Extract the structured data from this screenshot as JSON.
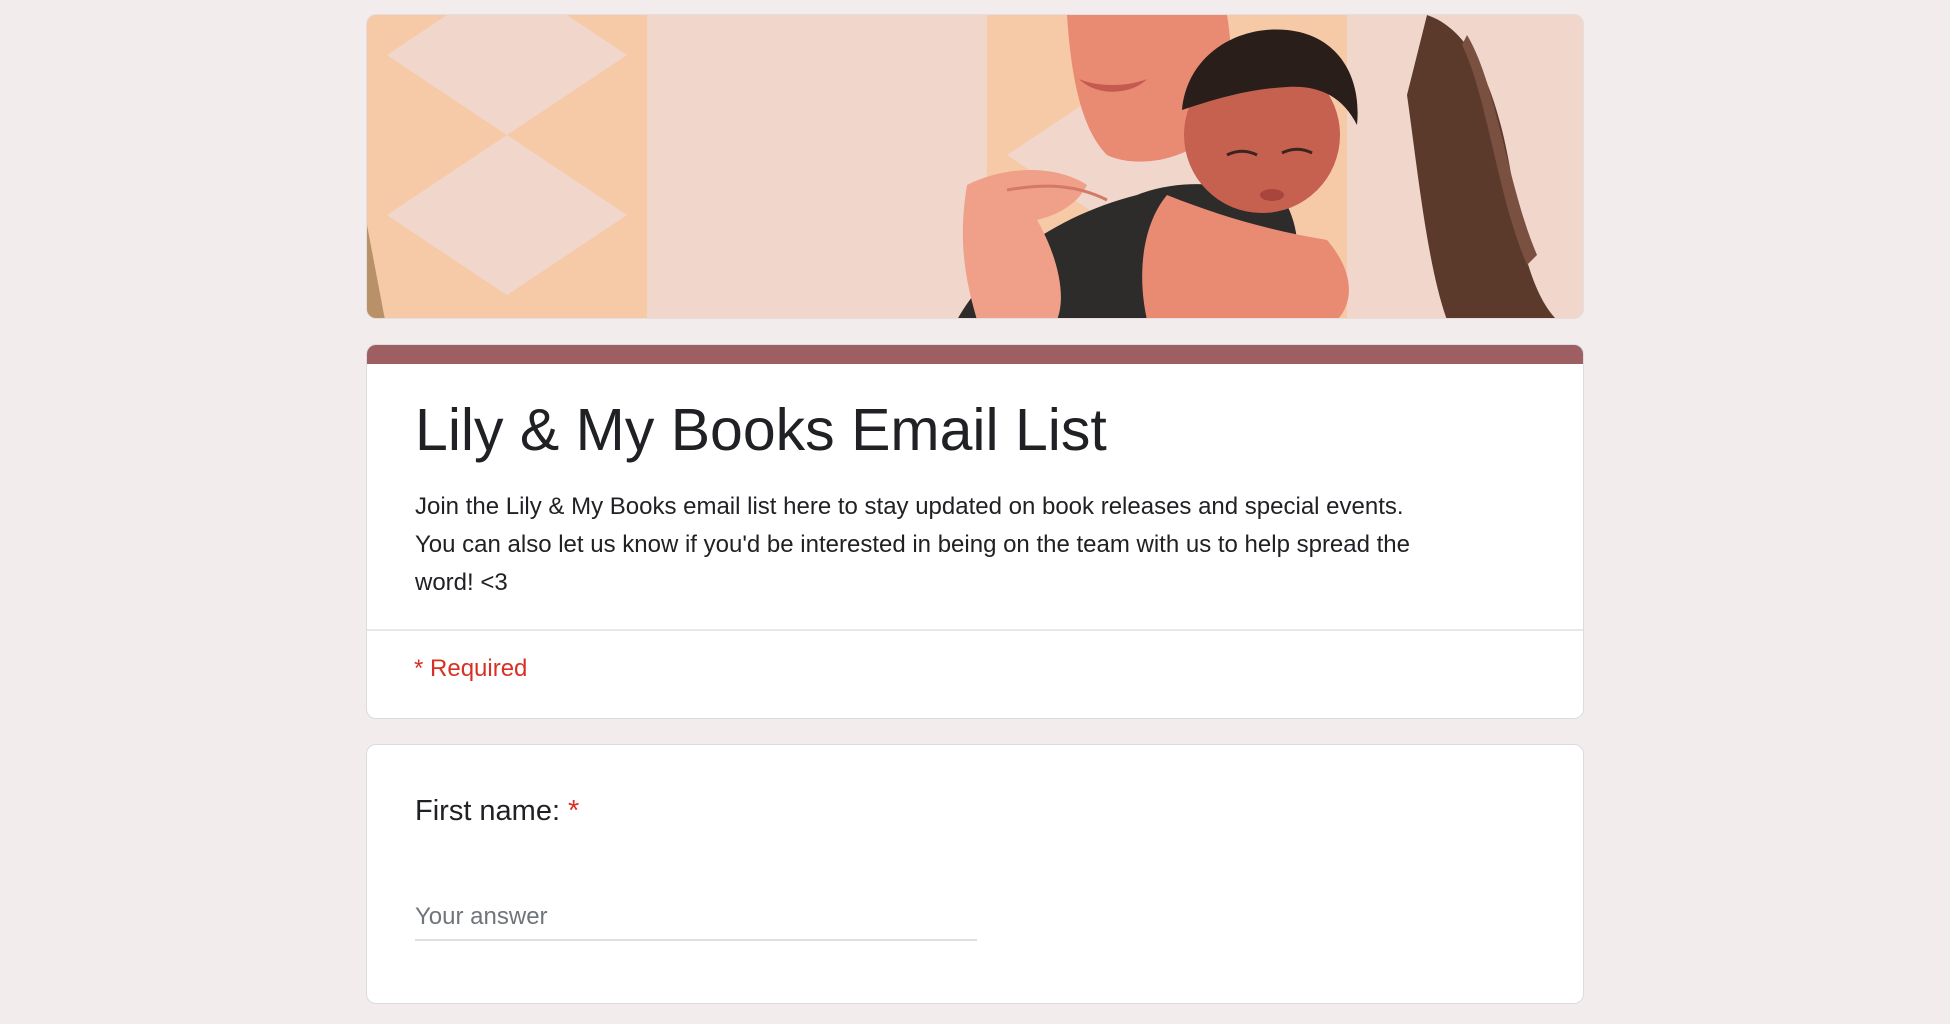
{
  "header_image": {
    "icon": "banner-illustration-mother-holding-baby",
    "colors": {
      "background": "#f1d6cc",
      "tile_light": "#f5e3dc",
      "tile_peach": "#f6c9a7",
      "skin": "#e98a73",
      "hair": "#5b3a2b",
      "clothing": "#2e2b2b"
    }
  },
  "form": {
    "accent_color": "#9d5f62",
    "title": "Lily & My Books Email List",
    "description": "Join the Lily & My Books email list here to stay updated on book releases and special events. You can also let us know if you'd be interested in being on the team with us to help spread the word! <3",
    "required_note": "* Required"
  },
  "questions": [
    {
      "label": "First name:",
      "required_marker": "*",
      "placeholder": "Your answer",
      "value": ""
    }
  ]
}
